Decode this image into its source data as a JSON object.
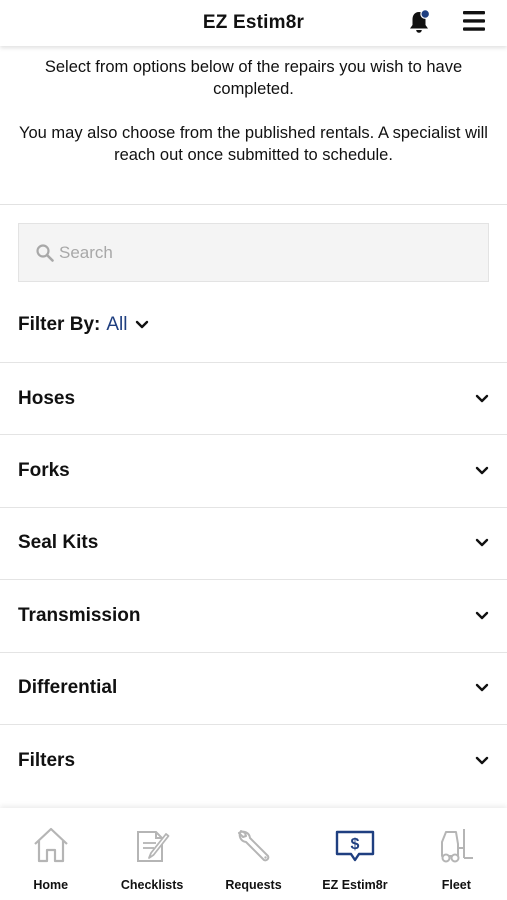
{
  "header": {
    "title": "EZ Estim8r",
    "notification_dot_color": "#1f3f80"
  },
  "intro": {
    "line1": "Select from options below of the repairs you wish to have completed.",
    "line2": "You may also choose from the published rentals. A specialist will reach out once submitted to schedule."
  },
  "search": {
    "placeholder": "Search",
    "value": ""
  },
  "filter": {
    "label": "Filter By:",
    "value": "All"
  },
  "categories": [
    {
      "label": "Hoses"
    },
    {
      "label": "Forks"
    },
    {
      "label": "Seal Kits"
    },
    {
      "label": "Transmission"
    },
    {
      "label": "Differential"
    },
    {
      "label": "Filters"
    }
  ],
  "tabs": [
    {
      "label": "Home",
      "icon": "home-icon",
      "active": false
    },
    {
      "label": "Checklists",
      "icon": "checklist-icon",
      "active": false
    },
    {
      "label": "Requests",
      "icon": "wrench-icon",
      "active": false
    },
    {
      "label": "EZ Estim8r",
      "icon": "estimate-icon",
      "active": true
    },
    {
      "label": "Fleet",
      "icon": "forklift-icon",
      "active": false
    }
  ],
  "colors": {
    "accent": "#1f3f80",
    "inactive_icon": "#b5b5b5"
  }
}
